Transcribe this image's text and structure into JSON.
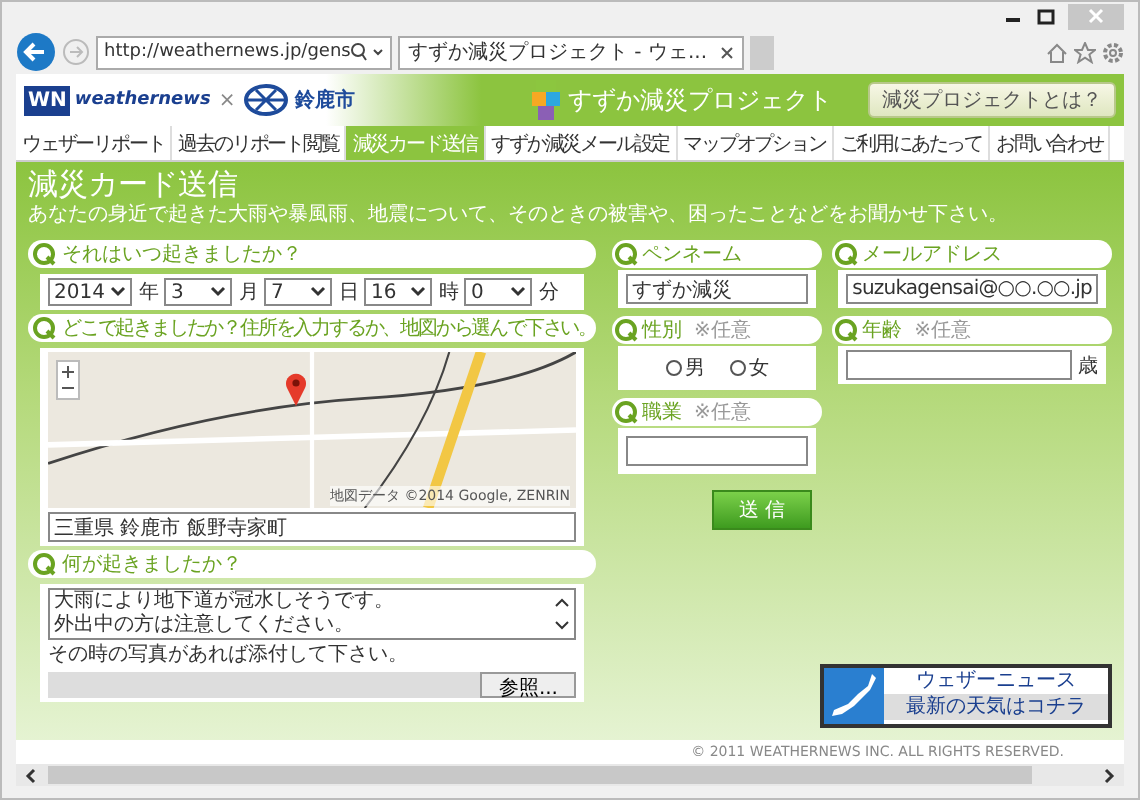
{
  "browser": {
    "url": "http://weathernews.jp/gens",
    "tab_title": "すずか減災プロジェクト - ウェ..."
  },
  "header": {
    "logo_mark": "WN",
    "logo_text": "weathernews",
    "cross": "×",
    "city": "鈴鹿市",
    "project_title": "すずか減災プロジェクト",
    "about_button": "減災プロジェクトとは？"
  },
  "nav": [
    {
      "label": "ウェザーリポート",
      "selected": false
    },
    {
      "label": "過去のリポート閲覧",
      "selected": false
    },
    {
      "label": "減災カード送信",
      "selected": true
    },
    {
      "label": "すずか減災メール設定",
      "selected": false
    },
    {
      "label": "マップオプション",
      "selected": false
    },
    {
      "label": "ご利用にあたって",
      "selected": false
    },
    {
      "label": "お問い合わせ",
      "selected": false
    }
  ],
  "page": {
    "title": "減災カード送信",
    "subtitle": "あなたの身近で起きた大雨や暴風雨、地震について、そのときの被害や、困ったことなどをお聞かせ下さい。"
  },
  "when": {
    "question": "それはいつ起きましたか？",
    "selects": [
      {
        "value": "2014",
        "unit": "年"
      },
      {
        "value": "3",
        "unit": "月"
      },
      {
        "value": "7",
        "unit": "日"
      },
      {
        "value": "16",
        "unit": "時"
      },
      {
        "value": "0",
        "unit": "分"
      }
    ]
  },
  "where": {
    "question": "どこで起きましたか？住所を入力するか、地図から選んで下さい。",
    "map_attribution": "地図データ ©2014 Google, ZENRIN",
    "address": "三重県 鈴鹿市 飯野寺家町"
  },
  "what": {
    "question": "何が起きましたか？",
    "lines": [
      "大雨により地下道が冠水しそうです。",
      "外出中の方は注意してください。"
    ],
    "photo_note": "その時の写真があれば添付して下さい。",
    "browse_button": "参照..."
  },
  "pen_name": {
    "question": "ペンネーム",
    "value": "すずか減災"
  },
  "email": {
    "question": "メールアドレス",
    "value": "suzukagensai@○○.○○.jp"
  },
  "gender": {
    "question": "性別",
    "note": "※任意",
    "options": [
      {
        "label": "男",
        "selected": false
      },
      {
        "label": "女",
        "selected": false
      }
    ]
  },
  "age": {
    "question": "年齢",
    "note": "※任意",
    "unit": "歳"
  },
  "occupation": {
    "question": "職業",
    "note": "※任意"
  },
  "submit": "送 信",
  "banner": {
    "line1": "ウェザーニュース",
    "line2": "最新の天気はコチラ"
  },
  "copyright": "© 2011 WEATHERNEWS INC. ALL RIGHTS RESERVED."
}
